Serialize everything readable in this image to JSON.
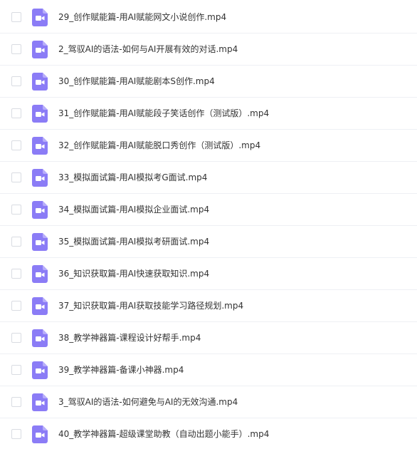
{
  "icon": "video-file-icon",
  "accent_color": "#8b7cf6",
  "files": [
    {
      "name": "29_创作赋能篇-用AI赋能网文小说创作.mp4"
    },
    {
      "name": "2_驾驭AI的语法-如何与AI开展有效的对话.mp4"
    },
    {
      "name": "30_创作赋能篇-用AI赋能剧本S创作.mp4"
    },
    {
      "name": "31_创作赋能篇-用AI赋能段子笑话创作（测试版）.mp4"
    },
    {
      "name": "32_创作赋能篇-用AI赋能脱口秀创作（测试版）.mp4"
    },
    {
      "name": "33_模拟面试篇-用AI模拟考G面试.mp4"
    },
    {
      "name": "34_模拟面试篇-用AI模拟企业面试.mp4"
    },
    {
      "name": "35_模拟面试篇-用AI模拟考研面试.mp4"
    },
    {
      "name": "36_知识获取篇-用AI快速获取知识.mp4"
    },
    {
      "name": "37_知识获取篇-用AI获取技能学习路径规划.mp4"
    },
    {
      "name": "38_教学神器篇-课程设计好帮手.mp4"
    },
    {
      "name": "39_教学神器篇-备课小神器.mp4"
    },
    {
      "name": "3_驾驭AI的语法-如何避免与AI的无效沟通.mp4"
    },
    {
      "name": "40_教学神器篇-超级课堂助教（自动出题小能手）.mp4"
    }
  ]
}
